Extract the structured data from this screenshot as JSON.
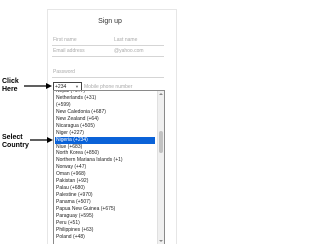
{
  "form": {
    "title": "Sign up",
    "first_name_placeholder": "First name",
    "last_name_placeholder": "Last name",
    "email_placeholder": "Email address",
    "email_domain": "@yahoo.com",
    "password_placeholder": "Password",
    "country_code_value": "+234",
    "phone_placeholder": "Mobile phone number"
  },
  "country_list": {
    "options": [
      "Nepal (+977)",
      "Netherlands (+31)",
      "(+599)",
      "New Caledonia (+687)",
      "New Zealand (+64)",
      "Nicaragua (+505)",
      "Niger (+227)",
      "Nigeria (+234)",
      "Niue (+683)",
      "North Korea (+850)",
      "Northern Mariana Islands (+1)",
      "Norway (+47)",
      "Oman (+968)",
      "Pakistan (+92)",
      "Palau (+680)",
      "Palestine (+970)",
      "Panama (+507)",
      "Papua New Guinea (+675)",
      "Paraguay (+595)",
      "Peru (+51)",
      "Philippines (+63)",
      "Poland (+48)"
    ],
    "selected": "Nigeria (+234)"
  },
  "annotations": {
    "click_line1": "Click",
    "click_line2": "Here",
    "select_line1": "Select",
    "select_line2": "Country"
  }
}
